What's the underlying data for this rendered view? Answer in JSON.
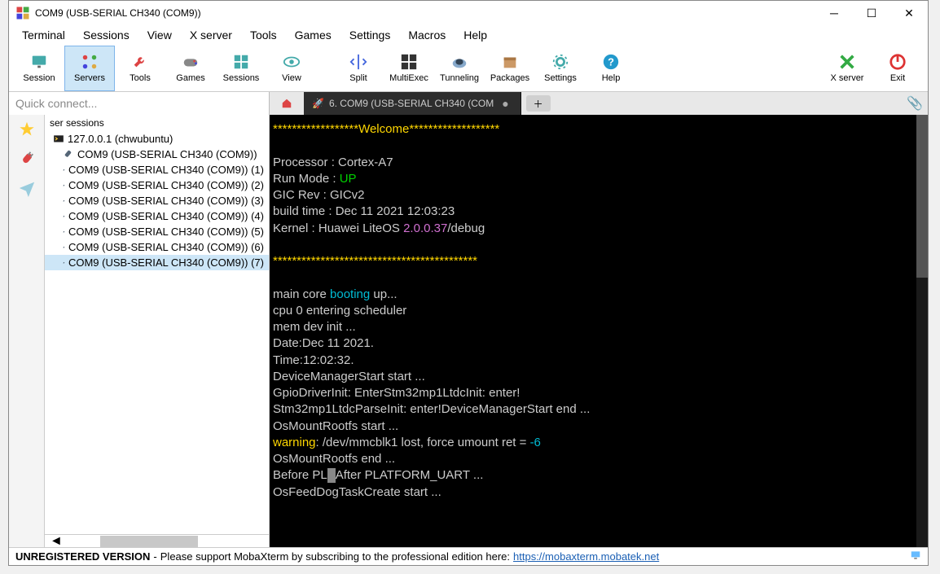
{
  "window": {
    "title": "COM9  (USB-SERIAL CH340 (COM9))"
  },
  "menubar": [
    "Terminal",
    "Sessions",
    "View",
    "X server",
    "Tools",
    "Games",
    "Settings",
    "Macros",
    "Help"
  ],
  "toolbar_left": [
    {
      "id": "session",
      "label": "Session",
      "icon": "monitor"
    },
    {
      "id": "servers",
      "label": "Servers",
      "icon": "dots",
      "selected": true
    },
    {
      "id": "tools",
      "label": "Tools",
      "icon": "wrench"
    },
    {
      "id": "games",
      "label": "Games",
      "icon": "gamepad"
    },
    {
      "id": "sessions",
      "label": "Sessions",
      "icon": "grid"
    },
    {
      "id": "view",
      "label": "View",
      "icon": "eye"
    },
    {
      "id": "split",
      "label": "Split",
      "icon": "split"
    },
    {
      "id": "multiexec",
      "label": "MultiExec",
      "icon": "terminal-grid"
    },
    {
      "id": "tunneling",
      "label": "Tunneling",
      "icon": "tunnel"
    },
    {
      "id": "packages",
      "label": "Packages",
      "icon": "package"
    },
    {
      "id": "settings",
      "label": "Settings",
      "icon": "gear"
    },
    {
      "id": "help",
      "label": "Help",
      "icon": "help"
    }
  ],
  "toolbar_right": [
    {
      "id": "xserver",
      "label": "X server",
      "icon": "xletter"
    },
    {
      "id": "exit",
      "label": "Exit",
      "icon": "power"
    }
  ],
  "quickconnect_placeholder": "Quick connect...",
  "tabs": {
    "active": {
      "label": "6. COM9  (USB-SERIAL CH340 (COM"
    }
  },
  "sidebar": {
    "header": "ser sessions",
    "ssh": "127.0.0.1 (chwubuntu)",
    "items": [
      "COM9  (USB-SERIAL CH340 (COM9))",
      "COM9  (USB-SERIAL CH340 (COM9)) (1)",
      "COM9  (USB-SERIAL CH340 (COM9)) (2)",
      "COM9  (USB-SERIAL CH340 (COM9)) (3)",
      "COM9  (USB-SERIAL CH340 (COM9)) (4)",
      "COM9  (USB-SERIAL CH340 (COM9)) (5)",
      "COM9  (USB-SERIAL CH340 (COM9)) (6)",
      "COM9  (USB-SERIAL CH340 (COM9)) (7)"
    ],
    "selected_index": 7
  },
  "terminal": {
    "welcome_stars_left": "******************",
    "welcome_text": "Welcome",
    "welcome_stars_right": "*******************",
    "proc_label": "Processor   : ",
    "proc_val": "Cortex-A7",
    "mode_label": "Run Mode    : ",
    "mode_val": "UP",
    "gic_label": "GIC Rev     : ",
    "gic_val": "GICv2",
    "build_label": "build time  : ",
    "build_val": "Dec 11 2021 12:03:23",
    "kernel_label": "Kernel      : ",
    "kernel_os": "Huawei LiteOS ",
    "kernel_ver": "2.0.0.37",
    "kernel_suffix": "/debug",
    "divider": "*******************************************",
    "boot_prefix": "main core ",
    "boot_cyan": "booting",
    "boot_suffix": " up...",
    "line_cpu": "cpu 0 entering scheduler",
    "line_mem": "mem dev init ...",
    "line_date": "Date:Dec 11 2021.",
    "line_time": "Time:12:02:32.",
    "line_dms": "DeviceManagerStart start ...",
    "line_gpio": "GpioDriverInit: EnterStm32mp1LtdcInit: enter!",
    "line_stm": "Stm32mp1LtdcParseInit: enter!DeviceManagerStart end ...",
    "line_mntstart": "OsMountRootfs start ...",
    "warn_label": "warning",
    "warn_text": ": /dev/mmcblk1 lost, force umount ret = ",
    "warn_val": "-6",
    "line_mntend": "OsMountRootfs end ...",
    "line_before": "Before PL",
    "line_after": "After PLATFORM_UART ...",
    "line_feed": "OsFeedDogTaskCreate start ..."
  },
  "statusbar": {
    "unregistered": "UNREGISTERED VERSION",
    "dash": "  -  ",
    "text": "Please support MobaXterm by subscribing to the professional edition here:  ",
    "url": "https://mobaxterm.mobatek.net"
  }
}
